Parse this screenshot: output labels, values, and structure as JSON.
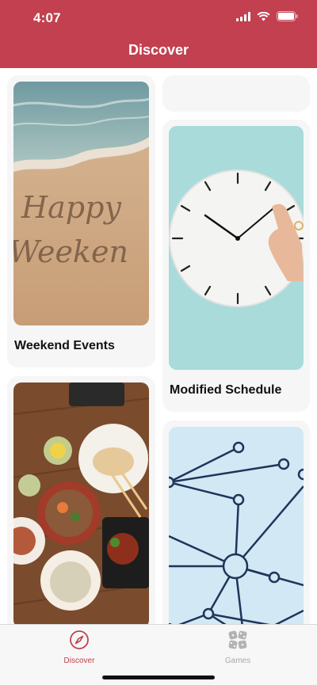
{
  "status_bar": {
    "time": "4:07"
  },
  "nav": {
    "title": "Discover"
  },
  "cards": [
    {
      "title": "Weekend Events",
      "image": "happy-weekend-beach-photo"
    },
    {
      "title": "Modified Schedule",
      "image": "wall-clock-photo"
    },
    {
      "title": "",
      "image": "food-table-photo"
    },
    {
      "title": "",
      "image": "network-graph-illustration"
    }
  ],
  "tabs": [
    {
      "label": "Discover",
      "icon": "compass-icon",
      "active": true
    },
    {
      "label": "Games",
      "icon": "dice-icon",
      "active": false
    }
  ],
  "colors": {
    "brand": "#c2404f",
    "tab_inactive": "#a9a9a9"
  }
}
